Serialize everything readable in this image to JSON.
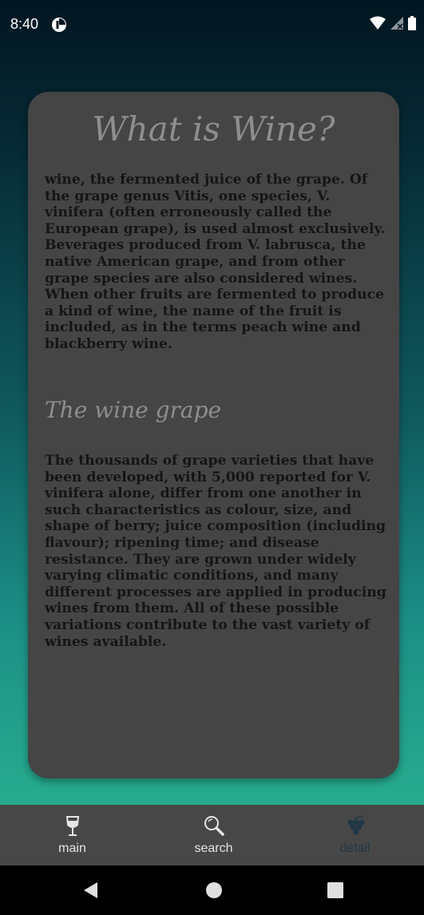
{
  "status_bar": {
    "time": "8:40"
  },
  "card": {
    "title": "What is Wine?",
    "paragraph_1": "wine, the fermented juice of the grape. Of the grape genus Vitis, one species, V. vinifera (often erroneously called the European grape), is used almost exclusively. Beverages produced from V. labrusca, the native American grape, and from other grape species are also considered wines. When other fruits are fermented to produce a kind of wine, the name of the fruit is included, as in the terms peach wine and blackberry wine.",
    "subtitle": "The wine grape",
    "paragraph_2": "The thousands of grape varieties that have been developed, with 5,000 reported for V. vinifera alone, differ from one another in such characteristics as colour, size, and shape of berry; juice composition (including flavour); ripening time; and disease resistance. They are grown under widely varying climatic conditions, and many different processes are applied in producing wines from them. All of these possible variations contribute to the vast variety of wines available."
  },
  "bottom_nav": {
    "items": [
      {
        "label": "main",
        "icon": "wine-glass-icon",
        "active": false
      },
      {
        "label": "search",
        "icon": "search-icon",
        "active": false
      },
      {
        "label": "detail",
        "icon": "grapes-icon",
        "active": true
      }
    ],
    "active_color": "#213846",
    "inactive_color": "#e4e4e4"
  },
  "system_nav": {
    "buttons": [
      "back-icon",
      "home-icon",
      "recents-icon"
    ]
  }
}
